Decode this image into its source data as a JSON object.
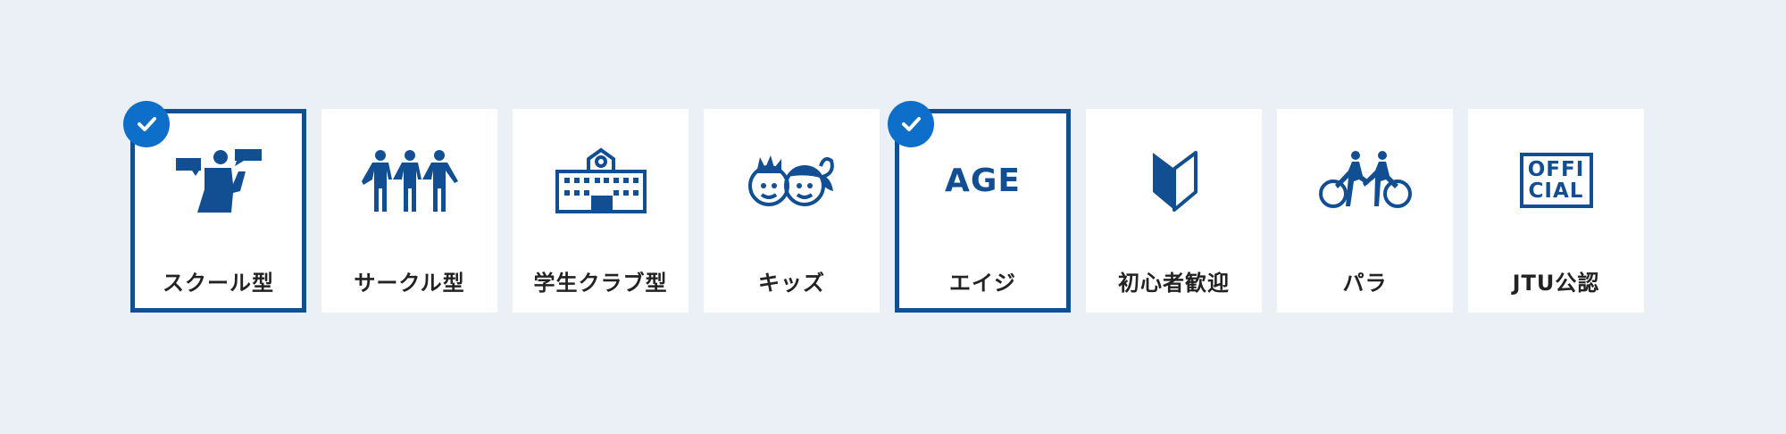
{
  "accent_color": "#124e92",
  "check_color": "#0d6fc9",
  "categories": [
    {
      "label": "スクール型",
      "icon": "school-type-icon",
      "selected": true
    },
    {
      "label": "サークル型",
      "icon": "circle-type-icon",
      "selected": false
    },
    {
      "label": "学生クラブ型",
      "icon": "student-club-icon",
      "selected": false
    },
    {
      "label": "キッズ",
      "icon": "kids-icon",
      "selected": false
    },
    {
      "label": "エイジ",
      "icon": "age-icon",
      "selected": true,
      "icon_text": "AGE"
    },
    {
      "label": "初心者歓迎",
      "icon": "beginner-mark-icon",
      "selected": false
    },
    {
      "label": "パラ",
      "icon": "para-tandem-bike-icon",
      "selected": false
    },
    {
      "label": "JTU公認",
      "icon": "official-icon",
      "selected": false,
      "icon_text_1": "OFFI",
      "icon_text_2": "CIAL"
    }
  ]
}
